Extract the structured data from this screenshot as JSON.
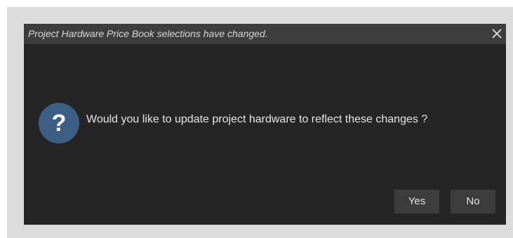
{
  "dialog": {
    "title": "Project Hardware Price Book selections have changed.",
    "message": "Would you like to update project hardware to reflect these changes ?",
    "close_icon": "close-icon",
    "question_icon": "question-mark-icon",
    "question_glyph": "?",
    "buttons": {
      "yes_label": "Yes",
      "no_label": "No"
    }
  },
  "colors": {
    "dialog_background": "#252525",
    "titlebar_background": "#3d3d3d",
    "icon_circle": "#3d5f85",
    "button_background": "#3c3c3c"
  }
}
